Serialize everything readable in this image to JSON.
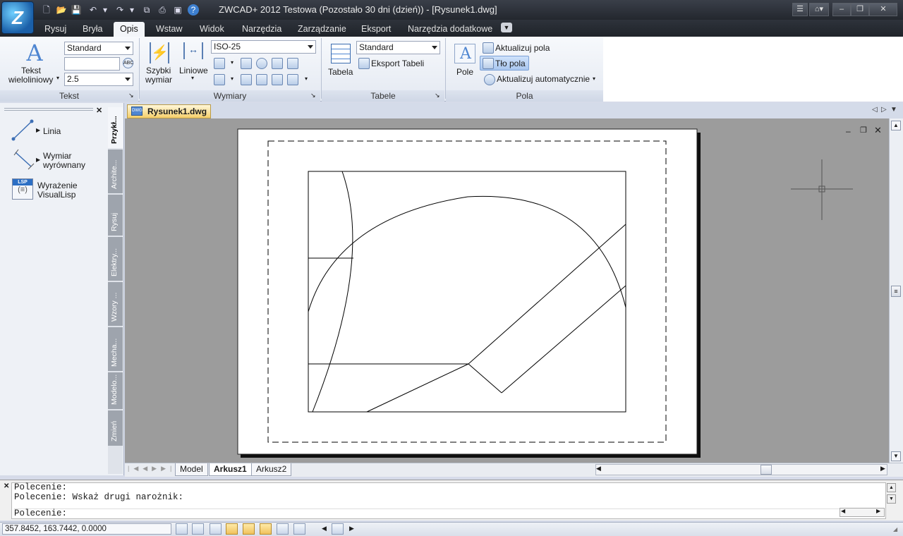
{
  "app": {
    "window_title": "ZWCAD+ 2012 Testowa (Pozostało 30 dni (dzień)) - [Rysunek1.dwg]",
    "logo_icon": "zwcad-logo-icon"
  },
  "quick_access": [
    "new-icon",
    "open-icon",
    "save-icon",
    "undo-icon",
    "redo-icon",
    "print-icon",
    "plot-preview-icon",
    "help-icon"
  ],
  "window_controls": {
    "minimize": "–",
    "restore": "❐",
    "close": "✕"
  },
  "menu_tabs": [
    "Rysuj",
    "Bryła",
    "Opis",
    "Wstaw",
    "Widok",
    "Narzędzia",
    "Zarządzanie",
    "Eksport",
    "Narzędzia dodatkowe"
  ],
  "active_menu_tab": "Opis",
  "ribbon": {
    "tekst": {
      "button_label_1": "Tekst",
      "button_label_2": "wieloliniowy",
      "style_combo": "Standard",
      "text_input": "",
      "height_combo": "2.5",
      "group_title": "Tekst"
    },
    "wymiary": {
      "quick_label_1": "Szybki",
      "quick_label_2": "wymiar",
      "linear_label": "Liniowe",
      "style_combo": "ISO-25",
      "group_title": "Wymiary"
    },
    "tabele": {
      "table_label": "Tabela",
      "style_combo": "Standard",
      "export_label": "Eksport Tabeli",
      "group_title": "Tabele"
    },
    "pola": {
      "field_label": "Pole",
      "update_fields": "Aktualizuj pola",
      "field_background": "Tło pola",
      "auto_update": "Aktualizuj automatycznie",
      "group_title": "Pola"
    }
  },
  "document_tab": "Rysunek1.dwg",
  "palette": {
    "items": [
      {
        "label_1": "Linia",
        "label_2": ""
      },
      {
        "label_1": "Wymiar",
        "label_2": "wyrównany"
      },
      {
        "label_1": "Wyrażenie",
        "label_2": "VisualLisp"
      }
    ],
    "tabs": [
      "Przykł...",
      "Archite...",
      "Rysuj",
      "Elektry...",
      "Wzory ...",
      "Mecha...",
      "Modelo...",
      "Zmień"
    ],
    "active_tab": "Przykł..."
  },
  "layout_tabs": [
    "Model",
    "Arkusz1",
    "Arkusz2"
  ],
  "active_layout_tab": "Arkusz1",
  "command": {
    "line_1": "Polecenie:",
    "line_2": "Polecenie: Wskaż drugi narożnik:",
    "prompt": "Polecenie:"
  },
  "status": {
    "coordinates": "357.8452, 163.7442, 0.0000"
  },
  "colors": {
    "title_bg": "#2b2f36",
    "ribbon_bg": "#eef2f8",
    "canvas_bg": "#9c9c9c",
    "doc_tab_bg": "#f5cf6b",
    "highlight": "#a9c7ef"
  }
}
